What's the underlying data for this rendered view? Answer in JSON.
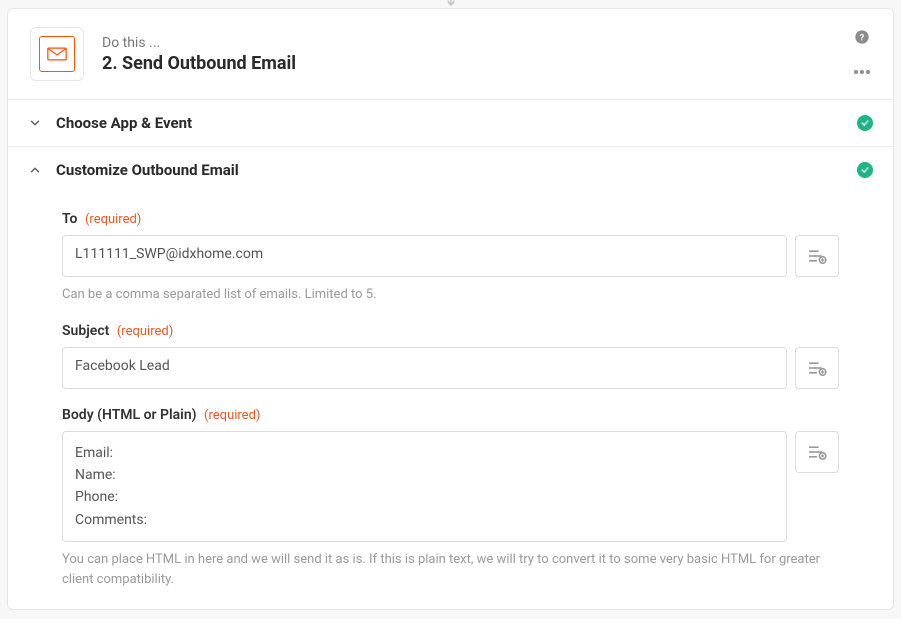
{
  "step": {
    "kicker": "Do this ...",
    "title": "2. Send Outbound Email"
  },
  "sections": {
    "chooseApp": {
      "title": "Choose App & Event"
    },
    "customize": {
      "title": "Customize Outbound Email"
    }
  },
  "form": {
    "to": {
      "label": "To",
      "req": "(required)",
      "value": "L111111_SWP@idxhome.com",
      "hint": "Can be a comma separated list of emails. Limited to 5."
    },
    "subject": {
      "label": "Subject",
      "req": "(required)",
      "value": "Facebook Lead"
    },
    "body": {
      "label": "Body (HTML or Plain)",
      "req": "(required)",
      "lines": {
        "l1": "Email:",
        "l2": "Name:",
        "l3": "Phone:",
        "l4": "Comments:"
      },
      "hint": "You can place HTML in here and we will send it as is. If this is plain text, we will try to convert it to some very basic HTML for greater client compatibility."
    }
  }
}
